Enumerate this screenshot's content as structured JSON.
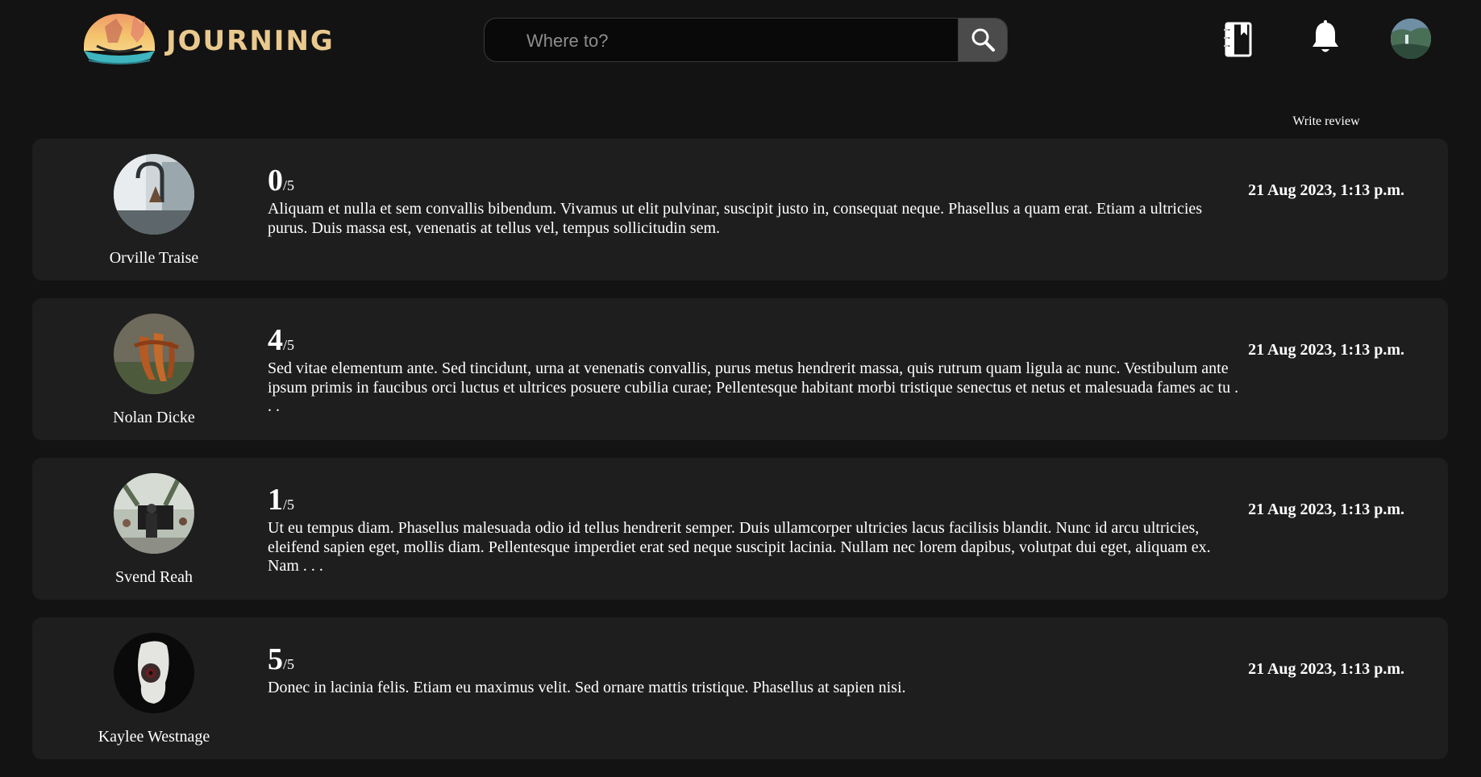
{
  "header": {
    "logo_text": "JOURNING",
    "search": {
      "placeholder": "Where to?",
      "value": ""
    },
    "icons": [
      "search-icon",
      "bookmark-journal-icon",
      "bell-icon",
      "user-avatar"
    ]
  },
  "actions": {
    "write_review_label": "Write review"
  },
  "reviews": [
    {
      "name": "Orville Traise",
      "score": "0",
      "out_of": "/5",
      "text": "Aliquam et nulla et sem convallis bibendum. Vivamus ut elit pulvinar, suscipit justo in, consequat neque. Phasellus a quam erat. Etiam a ultricies purus. Duis massa est, venenatis at tellus vel, tempus sollicitudin sem.",
      "date": "21 Aug 2023, 1:13 p.m."
    },
    {
      "name": "Nolan Dicke",
      "score": "4",
      "out_of": "/5",
      "text": "Sed vitae elementum ante. Sed tincidunt, urna at venenatis convallis, purus metus hendrerit massa, quis rutrum quam ligula ac nunc. Vestibulum ante ipsum primis in faucibus orci luctus et ultrices posuere cubilia curae; Pellentesque habitant morbi tristique senectus et netus et malesuada fames ac tu . . .",
      "date": "21 Aug 2023, 1:13 p.m."
    },
    {
      "name": "Svend Reah",
      "score": "1",
      "out_of": "/5",
      "text": "Ut eu tempus diam. Phasellus malesuada odio id tellus hendrerit semper. Duis ullamcorper ultricies lacus facilisis blandit. Nunc id arcu ultricies, eleifend sapien eget, mollis diam. Pellentesque imperdiet erat sed neque suscipit lacinia. Nullam nec lorem dapibus, volutpat dui eget, aliquam ex. Nam . . .",
      "date": "21 Aug 2023, 1:13 p.m."
    },
    {
      "name": "Kaylee Westnage",
      "score": "5",
      "out_of": "/5",
      "text": "Donec in lacinia felis. Etiam eu maximus velit. Sed ornare mattis tristique. Phasellus at sapien nisi.",
      "date": "21 Aug 2023, 1:13 p.m."
    }
  ]
}
